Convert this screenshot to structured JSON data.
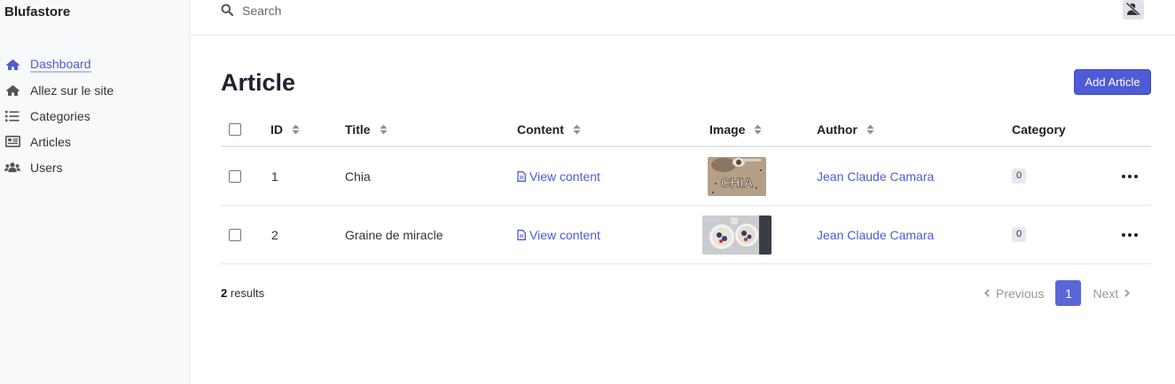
{
  "brand": "Blufastore",
  "sidebar": {
    "items": [
      {
        "label": "Dashboard",
        "icon": "home-icon",
        "active": true
      },
      {
        "label": "Allez sur le site",
        "icon": "home-icon"
      },
      {
        "label": "Categories",
        "icon": "list-icon"
      },
      {
        "label": "Articles",
        "icon": "newspaper-icon"
      },
      {
        "label": "Users",
        "icon": "users-icon"
      }
    ]
  },
  "topbar": {
    "search_placeholder": "Search",
    "avatar_icon": "user-slash-icon"
  },
  "page": {
    "title": "Article",
    "add_button": "Add Article"
  },
  "table": {
    "headers": {
      "id": "ID",
      "title": "Title",
      "content": "Content",
      "image": "Image",
      "author": "Author",
      "category": "Category"
    },
    "rows": [
      {
        "id": "1",
        "title": "Chia",
        "content": "View content",
        "image": "chia-seeds-photo",
        "author": "Jean Claude Camara",
        "category": "0"
      },
      {
        "id": "2",
        "title": "Graine de miracle",
        "content": "View content",
        "image": "bowls-photo",
        "author": "Jean Claude Camara",
        "category": "0"
      }
    ]
  },
  "footer": {
    "results_count": "2",
    "results_label": "results",
    "previous": "Previous",
    "current_page": "1",
    "next": "Next"
  },
  "colors": {
    "accent": "#4f5bd5",
    "badge_bg": "#e5e8ef",
    "sidebar_bg": "#f8f9fb"
  }
}
